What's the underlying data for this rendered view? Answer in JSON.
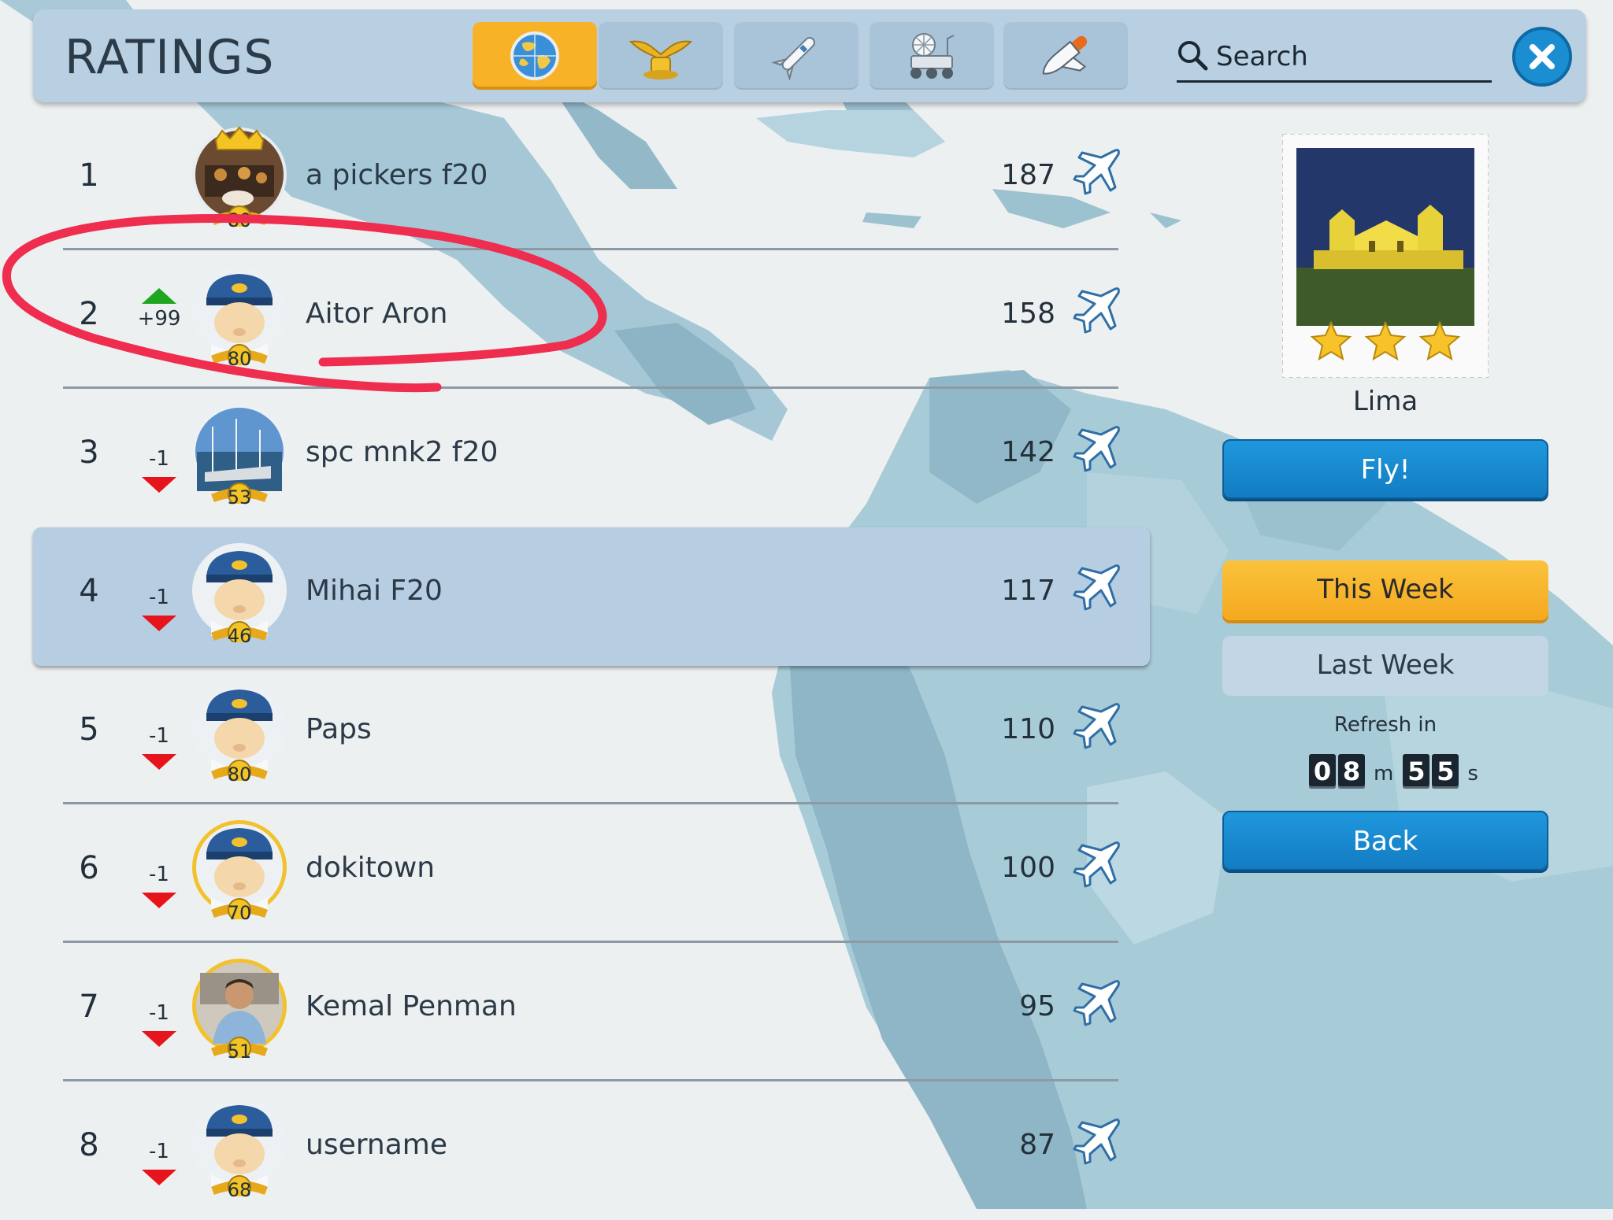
{
  "header": {
    "title": "RATINGS",
    "tabs": [
      {
        "icon": "globe-icon",
        "active": true
      },
      {
        "icon": "pilot-wings-icon",
        "active": false
      },
      {
        "icon": "rocket-icon",
        "active": false
      },
      {
        "icon": "rover-icon",
        "active": false
      },
      {
        "icon": "space-shuttle-icon",
        "active": false
      }
    ],
    "search_placeholder": "Search",
    "close_icon": "close-icon"
  },
  "leaderboard": [
    {
      "rank": "1",
      "delta": "",
      "trend": "none",
      "name": "a pickers f20",
      "level": "80",
      "score": "187",
      "avatar": "photo-crown"
    },
    {
      "rank": "2",
      "delta": "+99",
      "trend": "up",
      "name": "Aitor Aron",
      "level": "80",
      "score": "158",
      "avatar": "pilot"
    },
    {
      "rank": "3",
      "delta": "-1",
      "trend": "down",
      "name": "spc mnk2 f20",
      "level": "53",
      "score": "142",
      "avatar": "photo-sea"
    },
    {
      "rank": "4",
      "delta": "-1",
      "trend": "down",
      "name": "Mihai F20",
      "level": "46",
      "score": "117",
      "avatar": "pilot",
      "highlighted": true
    },
    {
      "rank": "5",
      "delta": "-1",
      "trend": "down",
      "name": "Paps",
      "level": "80",
      "score": "110",
      "avatar": "pilot"
    },
    {
      "rank": "6",
      "delta": "-1",
      "trend": "down",
      "name": "dokitown",
      "level": "70",
      "score": "100",
      "avatar": "pilot-gold"
    },
    {
      "rank": "7",
      "delta": "-1",
      "trend": "down",
      "name": "Kemal Penman",
      "level": "51",
      "score": "95",
      "avatar": "photo-man"
    },
    {
      "rank": "8",
      "delta": "-1",
      "trend": "down",
      "name": "username",
      "level": "68",
      "score": "87",
      "avatar": "pilot"
    }
  ],
  "panel": {
    "city": "Lima",
    "stars": 3,
    "fly_label": "Fly!",
    "this_week_label": "This Week",
    "last_week_label": "Last Week",
    "refresh_label": "Refresh in",
    "timer": {
      "m1": "0",
      "m2": "8",
      "m_unit": "m",
      "s1": "5",
      "s2": "5",
      "s_unit": "s"
    },
    "back_label": "Back"
  },
  "colors": {
    "accent": "#f8b228",
    "button_blue": "#1a8bd0",
    "up": "#1fa51f",
    "down": "#e6141b",
    "annotation": "#ee2d4f"
  }
}
